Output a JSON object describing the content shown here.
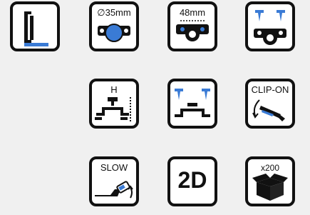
{
  "colors": {
    "accent": "#3a7bd5",
    "ink": "#111111",
    "tile_bg": "#ffffff",
    "page_bg": "#f0f0f0"
  },
  "icons": [
    {
      "name": "hinge-profile-icon",
      "label": ""
    },
    {
      "name": "cup-diameter-icon",
      "label": "∅35mm"
    },
    {
      "name": "hole-distance-icon",
      "label": "48mm"
    },
    {
      "name": "screw-fixing-icon",
      "label": ""
    },
    {
      "name": "height-adjust-icon",
      "label": "H"
    },
    {
      "name": "screw-adjust-icon",
      "label": ""
    },
    {
      "name": "clip-on-icon",
      "label": "CLIP-ON"
    },
    {
      "name": "soft-close-icon",
      "label": "SLOW"
    },
    {
      "name": "2d-adjust-icon",
      "label": "2D"
    },
    {
      "name": "pack-quantity-icon",
      "label": "x200"
    }
  ]
}
